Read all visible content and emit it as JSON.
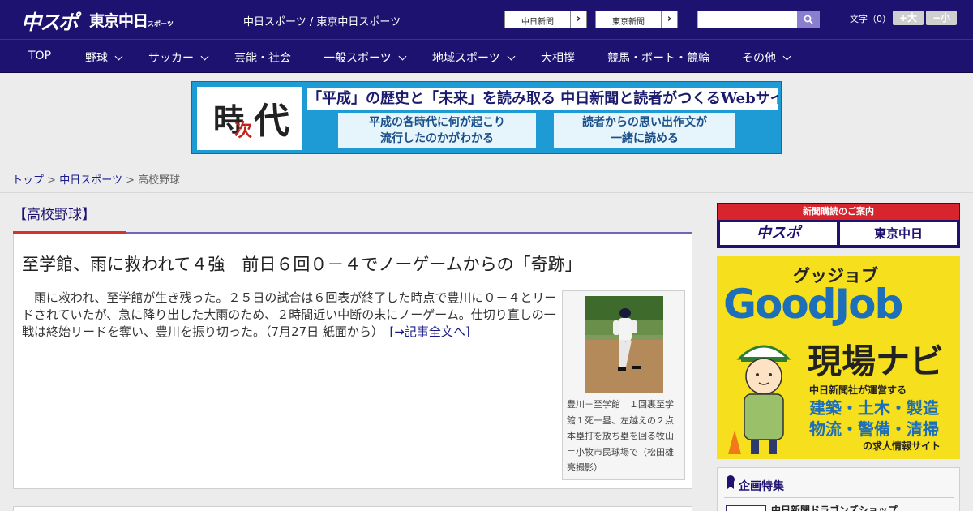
{
  "header": {
    "logo_chunichi_sports": "中スポ",
    "logo_tokyo_chunichi": "東京中日",
    "logo_tokyo_small": "スポーツ",
    "site_title": "中日スポーツ / 東京中日スポーツ",
    "paper_links": [
      "中日新聞",
      "東京新聞"
    ],
    "font_size_label": "文字（0）",
    "font_bigger": "+大",
    "font_smaller": "−小",
    "search_placeholder": ""
  },
  "nav": {
    "items": [
      {
        "label": "TOP",
        "dropdown": false
      },
      {
        "label": "野球",
        "dropdown": true
      },
      {
        "label": "サッカー",
        "dropdown": true
      },
      {
        "label": "芸能・社会",
        "dropdown": false
      },
      {
        "label": "一般スポーツ",
        "dropdown": true
      },
      {
        "label": "地域スポーツ",
        "dropdown": true
      },
      {
        "label": "大相撲",
        "dropdown": false
      },
      {
        "label": "競馬・ボート・競輪",
        "dropdown": false
      },
      {
        "label": "その他",
        "dropdown": true
      }
    ]
  },
  "banner": {
    "kanji_1": "時",
    "kanji_2": "次",
    "kanji_3": "代",
    "headline": "「平成」の歴史と「未来」を読み取る 中日新聞と読者がつくるWebサイト",
    "left_line1": "平成の各時代に何が起こり",
    "left_line2": "流行したのかがわかる",
    "right_line1": "読者からの思い出作文が",
    "right_line2": "一緒に読める"
  },
  "breadcrumb": {
    "home": "トップ",
    "sep": ">",
    "section": "中日スポーツ",
    "current": "高校野球"
  },
  "section": {
    "label": "【高校野球】"
  },
  "article": {
    "title": "至学館、雨に救われて４強　前日６回０－４でノーゲームからの「奇跡」",
    "body": "　雨に救われ、至学館が生き残った。２５日の試合は６回表が終了した時点で豊川に０－４とリードされていたが、急に降り出した大雨のため、２時間近い中断の末にノーゲーム。仕切り直しの一戦は終始リードを奪い、豊川を振り切った。（7月27日 紙面から）　",
    "read_more": "[→記事全文へ]",
    "photo_caption": "豊川－至学館　１回裏至学館１死一塁、左越えの２点本塁打を放ち塁を回る牧山＝小牧市民球場で（松田雄亮撮影）"
  },
  "sidebar": {
    "subscribe_head": "新聞購読のご案内",
    "subscribe_left": "中スポ",
    "subscribe_right": "東京中日",
    "ad": {
      "small": "グッジョブ",
      "big": "GoodJob",
      "title": "現場ナビ",
      "runs": "中日新聞社が運営する",
      "jobs_line1": "建築・土木・製造",
      "jobs_line2": "物流・警備・清掃",
      "site": "の求人情報サイト"
    },
    "feature_title": "企画特集",
    "feature_item": "中日新聞ドラゴンズショップ"
  },
  "colors": {
    "header_bg": "#1e1271",
    "accent_red": "#d8302b",
    "link": "#1a1a8a",
    "ad_yellow": "#f6df1c",
    "ad_blue": "#1c6fb8"
  }
}
